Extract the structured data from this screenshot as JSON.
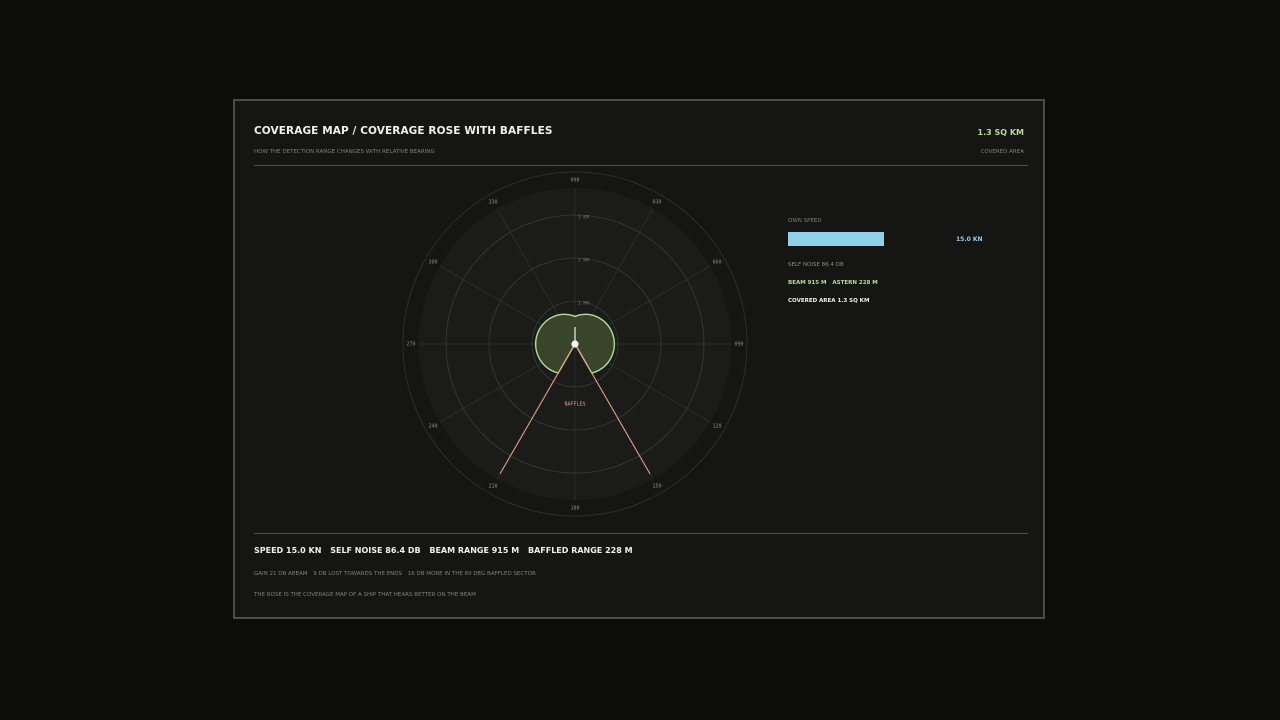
{
  "header": {
    "title": "COVERAGE MAP / COVERAGE ROSE WITH BAFFLES",
    "subtitle": "HOW THE DETECTION RANGE CHANGES WITH RELATIVE BEARING",
    "area_value": "1.3 SQ KM",
    "area_label": "COVERED AREA"
  },
  "rose": {
    "bearings": [
      "000",
      "030",
      "060",
      "090",
      "120",
      "150",
      "180",
      "210",
      "240",
      "270",
      "300",
      "330"
    ],
    "range_rings": [
      "1 KM",
      "2 KM",
      "3 KM"
    ],
    "baffles_label": "BAFFLES"
  },
  "side": {
    "speed_label": "OWN SPEED",
    "speed_value": "15.0 KN",
    "speed_fraction": 0.6,
    "self_noise": "SELF NOISE 86.4 DB",
    "beam": "BEAM 915 M",
    "astern": "ASTERN 228 M",
    "covered": "COVERED AREA 1.3 SQ KM"
  },
  "stats": [
    "SPEED",
    "15.0 KN",
    "SELF NOISE",
    "86.4 DB",
    "BEAM RANGE",
    "915 M",
    "BAFFLED RANGE",
    "228 M"
  ],
  "notes": {
    "line1": [
      "GAIN 21 DB ABEAM",
      "9 DB LOST TOWARDS THE ENDS",
      "16 DB MORE IN THE 60 DEG BAFFLED SECTOR"
    ],
    "line2": "THE ROSE IS THE COVERAGE MAP OF A SHIP THAT HEARS BETTER ON THE BEAM"
  },
  "colors": {
    "coverage_stroke": "#b6dc98",
    "coverage_fill": "#3c4a2c",
    "baffle_line": "#e89a86",
    "speed_bar": "#8fd0ea"
  }
}
